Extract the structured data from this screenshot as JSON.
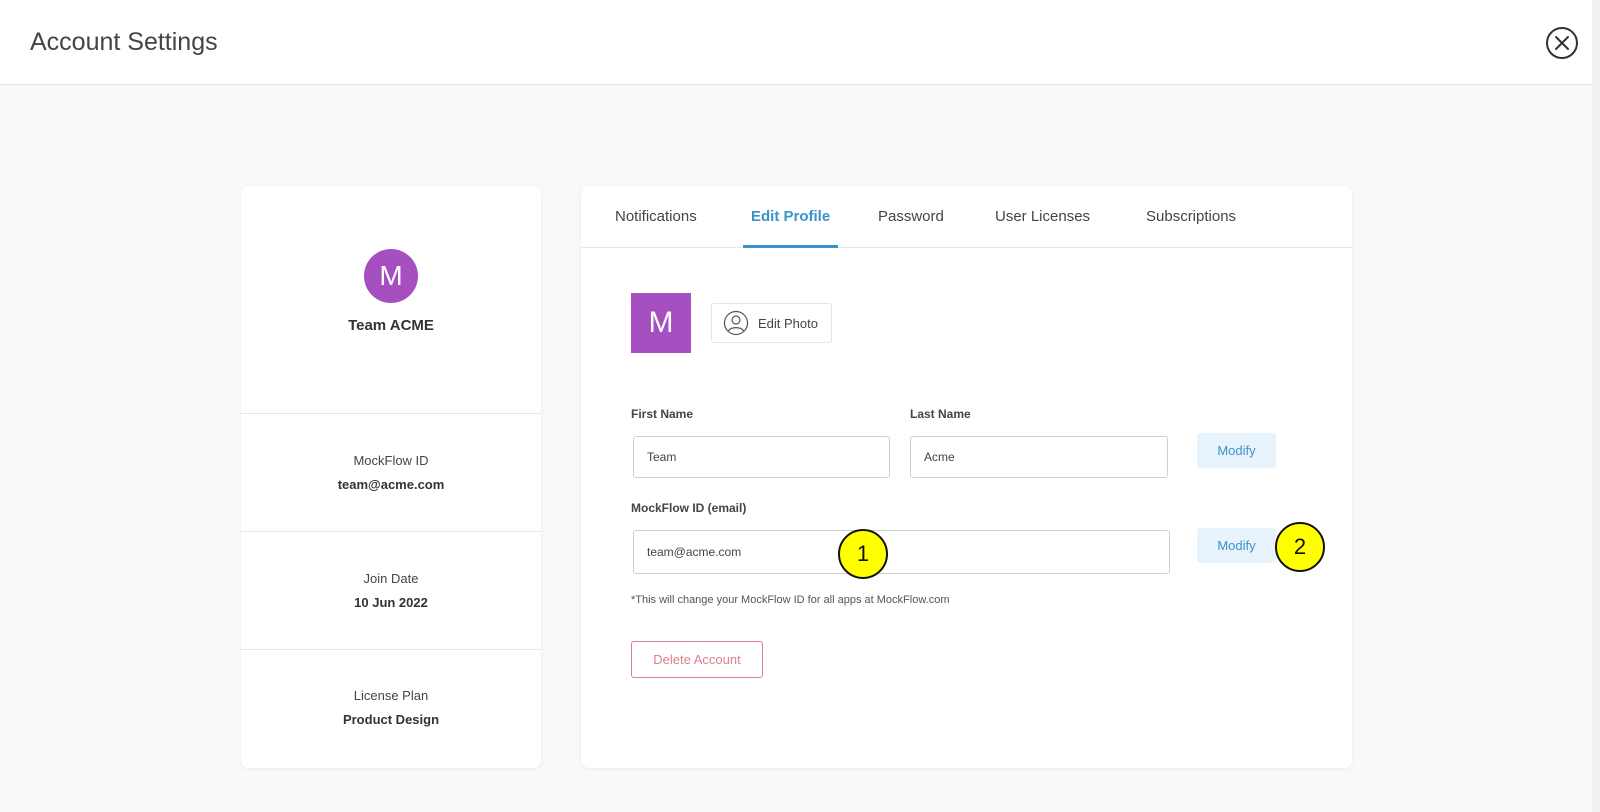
{
  "header": {
    "title": "Account Settings"
  },
  "profile_card": {
    "avatar_letter": "M",
    "name": "Team ACME",
    "mockflow_id_label": "MockFlow ID",
    "mockflow_id_value": "team@acme.com",
    "join_date_label": "Join Date",
    "join_date_value": "10 Jun 2022",
    "license_plan_label": "License Plan",
    "license_plan_value": "Product Design"
  },
  "tabs": [
    {
      "label": "Notifications",
      "active": false
    },
    {
      "label": "Edit Profile",
      "active": true
    },
    {
      "label": "Password",
      "active": false
    },
    {
      "label": "User Licenses",
      "active": false
    },
    {
      "label": "Subscriptions",
      "active": false
    }
  ],
  "edit_profile": {
    "photo_letter": "M",
    "edit_photo_label": "Edit Photo",
    "first_name_label": "First Name",
    "first_name_value": "Team",
    "last_name_label": "Last Name",
    "last_name_value": "Acme",
    "name_modify_label": "Modify",
    "email_label": "MockFlow ID (email)",
    "email_value": "team@acme.com",
    "email_modify_label": "Modify",
    "hint": "*This will change your MockFlow ID for all apps at MockFlow.com",
    "delete_label": "Delete Account"
  },
  "markers": [
    "1",
    "2"
  ],
  "colors": {
    "accent": "#3a93c9",
    "avatar": "#a64fc1",
    "danger": "#d9818e",
    "marker": "#ffff00"
  }
}
